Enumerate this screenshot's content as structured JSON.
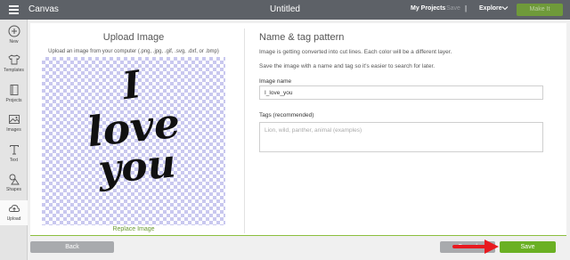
{
  "topbar": {
    "app_title": "Canvas",
    "document_title": "Untitled",
    "my_projects": "My Projects",
    "save": "Save",
    "separator": "|",
    "explore": "Explore",
    "make_it": "Make It"
  },
  "sidebar": {
    "items": [
      {
        "label": "New",
        "icon": "plus-circle-icon"
      },
      {
        "label": "Templates",
        "icon": "shirt-icon"
      },
      {
        "label": "Projects",
        "icon": "book-icon"
      },
      {
        "label": "Images",
        "icon": "image-icon"
      },
      {
        "label": "Text",
        "icon": "text-icon"
      },
      {
        "label": "Shapes",
        "icon": "shapes-icon"
      },
      {
        "label": "Upload",
        "icon": "cloud-upload-icon"
      }
    ],
    "active_item": "Upload"
  },
  "upload": {
    "title": "Upload Image",
    "subtitle": "Upload an image from your computer (.png, .jpg, .gif, .svg, .dxf, or .bmp)",
    "preview_text": [
      "I",
      "love",
      "you"
    ],
    "replace_link": "Replace Image"
  },
  "details": {
    "title": "Name & tag pattern",
    "description_1": "Image is getting converted into cut lines. Each color will be a different layer.",
    "description_2": "Save the image with a name and tag so it's easier to search for later.",
    "image_name_label": "Image name",
    "image_name_value": "I_love_you",
    "tags_label": "Tags (recommended)",
    "tags_placeholder": "Lion, wild, panther, animal (examples)"
  },
  "footer": {
    "back": "Back",
    "cancel": "Cancel",
    "save": "Save"
  },
  "colors": {
    "topbar": "#5d6167",
    "accent_green": "#6ab023",
    "annotation_arrow": "#e8191f"
  }
}
